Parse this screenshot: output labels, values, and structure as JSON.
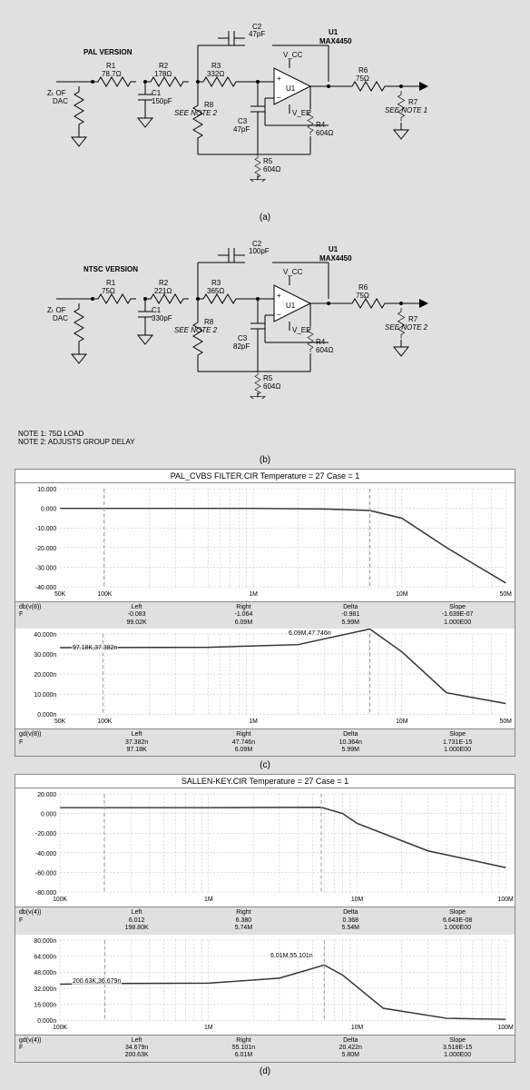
{
  "schematics": {
    "pal": {
      "version_label": "PAL VERSION",
      "u1_label": "U1",
      "u1_part": "MAX4450",
      "zt": "Zₜ OF\nDAC",
      "r1": {
        "label": "R1",
        "value": "78.7Ω"
      },
      "r2": {
        "label": "R2",
        "value": "178Ω"
      },
      "r3": {
        "label": "R3",
        "value": "332Ω"
      },
      "r4": {
        "label": "R4",
        "value": "604Ω"
      },
      "r5": {
        "label": "R5",
        "value": "604Ω"
      },
      "r6": {
        "label": "R6",
        "value": "75Ω"
      },
      "r7": {
        "label": "R7",
        "value": "SEE NOTE 1"
      },
      "r8": {
        "label": "R8",
        "value": "SEE NOTE 2"
      },
      "c1": {
        "label": "C1",
        "value": "150pF"
      },
      "c2": {
        "label": "C2",
        "value": "47pF"
      },
      "c3": {
        "label": "C3",
        "value": "47pF"
      },
      "vcc": "V_CC",
      "vee": "V_EE",
      "sublabel": "(a)"
    },
    "ntsc": {
      "version_label": "NTSC VERSION",
      "u1_label": "U1",
      "u1_part": "MAX4450",
      "zt": "Zₜ OF\nDAC",
      "r1": {
        "label": "R1",
        "value": "75Ω"
      },
      "r2": {
        "label": "R2",
        "value": "221Ω"
      },
      "r3": {
        "label": "R3",
        "value": "365Ω"
      },
      "r4": {
        "label": "R4",
        "value": "604Ω"
      },
      "r5": {
        "label": "R5",
        "value": "604Ω"
      },
      "r6": {
        "label": "R6",
        "value": "75Ω"
      },
      "r7": {
        "label": "R7",
        "value": "SEE  NOTE 2"
      },
      "r8": {
        "label": "R8",
        "value": "SEE NOTE 2"
      },
      "c1": {
        "label": "C1",
        "value": "330pF"
      },
      "c2": {
        "label": "C2",
        "value": "100pF"
      },
      "c3": {
        "label": "C3",
        "value": "82pF"
      },
      "vcc": "V_CC",
      "vee": "V_EE",
      "sublabel": "(b)"
    },
    "note1": "NOTE 1: 75Ω LOAD",
    "note2": "NOTE 2: ADJUSTS GROUP DELAY"
  },
  "chart_data": [
    {
      "id": "pal_chart",
      "title": "PAL_CVBS FILTER.CIR Temperature = 27 Case = 1",
      "sublabel": "(c)",
      "panels": [
        {
          "type": "line",
          "ylabel_ticks": [
            "10.000",
            "0.000",
            "-10.000",
            "-20.000",
            "-30.000",
            "-40.000"
          ],
          "ylim": [
            -40,
            10
          ],
          "xaxis_ticks": [
            "50K",
            "100K",
            "1M",
            "10M",
            "50M"
          ],
          "xlim": [
            50000,
            50000000
          ],
          "signal": "db(v(8))",
          "xvar": "F",
          "cursors": {
            "Left": {
              "y": "-0.083",
              "x": "99.02K"
            },
            "Right": {
              "y": "-1.064",
              "x": "6.09M"
            },
            "Delta": {
              "y": "-0.981",
              "x": "5.99M"
            },
            "Slope": {
              "y": "-1.639E-07",
              "x": "1.000E00"
            }
          },
          "data_points_hz_db": [
            [
              50000,
              0
            ],
            [
              100000,
              0
            ],
            [
              1000000,
              0
            ],
            [
              3000000,
              -0.3
            ],
            [
              6090000,
              -1.064
            ],
            [
              10000000,
              -5
            ],
            [
              20000000,
              -20
            ],
            [
              50000000,
              -38
            ]
          ]
        },
        {
          "type": "line",
          "ylabel_ticks": [
            "40.000n",
            "30.000n",
            "20.000n",
            "10.000n",
            "0.000n"
          ],
          "ylim_n": [
            0,
            45
          ],
          "xaxis_ticks": [
            "50K",
            "100K",
            "1M",
            "10M",
            "50M"
          ],
          "xlim": [
            50000,
            50000000
          ],
          "signal": "gd(v(8))",
          "xvar": "F",
          "markers": [
            "97.18K,37.382n",
            "6.09M,47.746n"
          ],
          "cursors": {
            "Left": {
              "y": "37.382n",
              "x": "97.18K"
            },
            "Right": {
              "y": "47.746n",
              "x": "6.09M"
            },
            "Delta": {
              "y": "10.364n",
              "x": "5.99M"
            },
            "Slope": {
              "y": "1.731E-15",
              "x": "1.000E00"
            }
          },
          "data_points_hz_ns": [
            [
              50000,
              37.3
            ],
            [
              97180,
              37.382
            ],
            [
              500000,
              37.5
            ],
            [
              2000000,
              39
            ],
            [
              6090000,
              47.746
            ],
            [
              10000000,
              35
            ],
            [
              20000000,
              12
            ],
            [
              50000000,
              6
            ]
          ]
        }
      ]
    },
    {
      "id": "sallen_chart",
      "title": "SALLEN-KEY.CIR Temperature = 27 Case = 1",
      "sublabel": "(d)",
      "panels": [
        {
          "type": "line",
          "ylabel_ticks": [
            "20.000",
            "0.000",
            "-20.000",
            "-40.000",
            "-60.000",
            "-80.000"
          ],
          "ylim": [
            -80,
            20
          ],
          "xaxis_ticks": [
            "100K",
            "1M",
            "10M",
            "100M"
          ],
          "xlim": [
            100000,
            100000000
          ],
          "signal": "db(v(4))",
          "xvar": "F",
          "cursors": {
            "Left": {
              "y": "6.012",
              "x": "198.80K"
            },
            "Right": {
              "y": "6.380",
              "x": "5.74M"
            },
            "Delta": {
              "y": "0.368",
              "x": "5.54M"
            },
            "Slope": {
              "y": "6.643E-08",
              "x": "1.000E00"
            }
          },
          "data_points_hz_db": [
            [
              100000,
              6
            ],
            [
              1000000,
              6
            ],
            [
              5740000,
              6.38
            ],
            [
              8000000,
              0
            ],
            [
              10000000,
              -10
            ],
            [
              30000000,
              -38
            ],
            [
              100000000,
              -55
            ]
          ]
        },
        {
          "type": "line",
          "ylabel_ticks": [
            "80.000n",
            "64.000n",
            "48.000n",
            "32.000n",
            "16.000n",
            "0.000n"
          ],
          "ylim_n": [
            0,
            80
          ],
          "xaxis_ticks": [
            "100K",
            "1M",
            "10M",
            "100M"
          ],
          "xlim": [
            100000,
            100000000
          ],
          "signal": "gd(v(4))",
          "xvar": "F",
          "markers": [
            "200.63K,36.679n",
            "6.01M,55.101n"
          ],
          "cursors": {
            "Left": {
              "y": "34.679n",
              "x": "200.63K"
            },
            "Right": {
              "y": "55.101n",
              "x": "6.01M"
            },
            "Delta": {
              "y": "20.422n",
              "x": "5.80M"
            },
            "Slope": {
              "y": "3.518E-15",
              "x": "1.000E00"
            }
          },
          "data_points_hz_ns": [
            [
              100000,
              36
            ],
            [
              200630,
              36.679
            ],
            [
              1000000,
              37
            ],
            [
              3000000,
              42
            ],
            [
              6010000,
              55.101
            ],
            [
              8000000,
              45
            ],
            [
              15000000,
              12
            ],
            [
              40000000,
              2
            ],
            [
              100000000,
              1
            ]
          ]
        }
      ]
    }
  ]
}
